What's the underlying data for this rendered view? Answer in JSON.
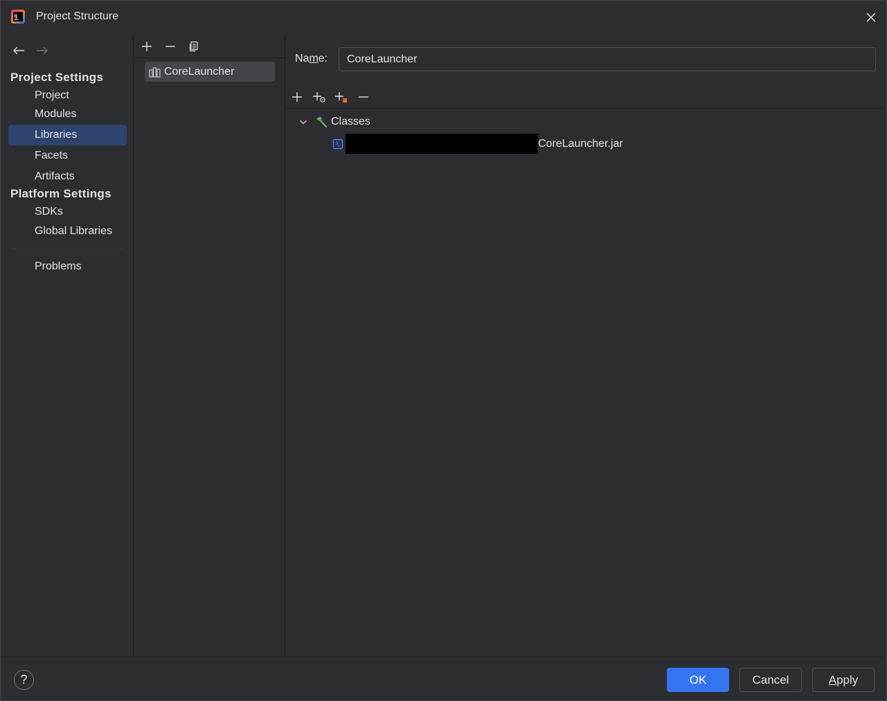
{
  "window": {
    "title": "Project Structure"
  },
  "sidebar": {
    "project_settings_title": "Project Settings",
    "platform_settings_title": "Platform Settings",
    "items": {
      "project": "Project",
      "modules": "Modules",
      "libraries": "Libraries",
      "facets": "Facets",
      "artifacts": "Artifacts",
      "sdks": "SDKs",
      "global_libraries": "Global Libraries",
      "problems": "Problems"
    },
    "selected": "Libraries"
  },
  "libraries_list": {
    "items": [
      "CoreLauncher"
    ],
    "selected": "CoreLauncher"
  },
  "detail": {
    "name_label_prefix": "Na",
    "name_label_underlined": "m",
    "name_label_suffix": "e:",
    "name_value": "CoreLauncher",
    "tree": {
      "root_label": "Classes",
      "entry_label": "CoreLauncher.jar"
    }
  },
  "footer": {
    "help": "?",
    "ok": "OK",
    "cancel": "Cancel",
    "apply_underlined": "A",
    "apply_rest": "pply"
  },
  "colors": {
    "accent": "#3574f0",
    "selection": "#2e436e",
    "background": "#2b2d30"
  },
  "icons": [
    "app-logo-icon",
    "close-icon",
    "back-arrow-icon",
    "forward-arrow-icon",
    "add-icon",
    "remove-icon",
    "copy-icon",
    "library-icon",
    "add-jar-icon",
    "add-special-icon",
    "expand-chevron-icon",
    "classes-hammer-icon",
    "jar-file-icon"
  ]
}
